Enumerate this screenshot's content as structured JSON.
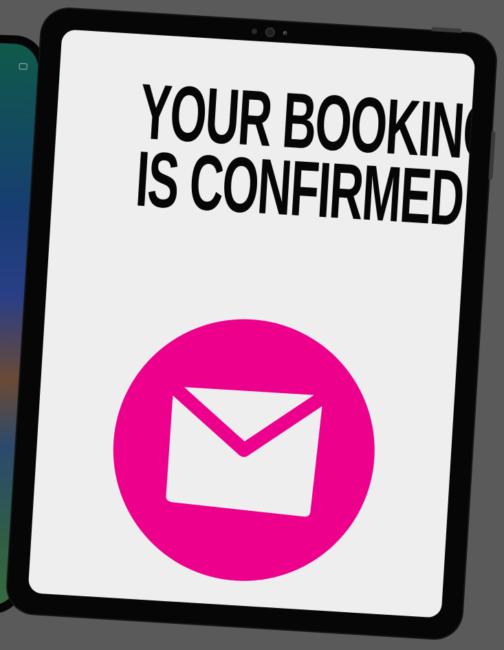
{
  "screen": {
    "headline_line1": "YOUR BOOKING",
    "headline_line2": "IS CONFIRMED"
  },
  "icons": {
    "badge_icon": "envelope-icon"
  },
  "colors": {
    "background": "#5a5a5a",
    "device_frame": "#060606",
    "screen_background": "#eeeeee",
    "headline_text": "#060606",
    "badge": "#ec008c",
    "icon": "#eeeeee"
  }
}
